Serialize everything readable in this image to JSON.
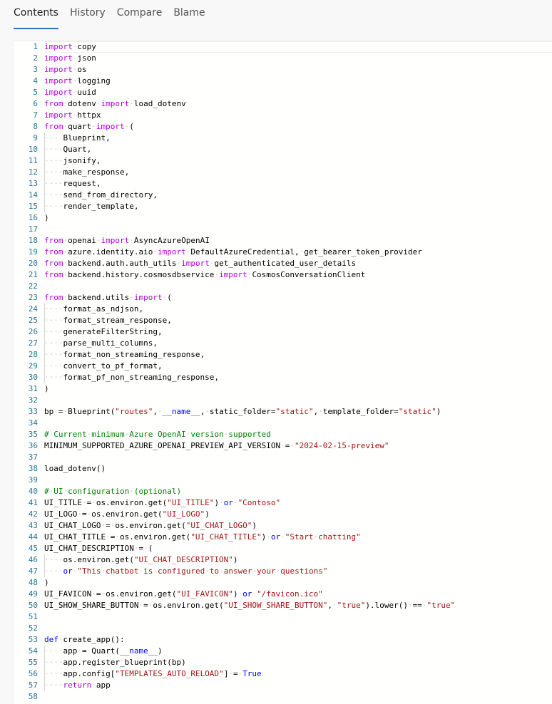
{
  "tabs": [
    {
      "label": "Contents",
      "active": true
    },
    {
      "label": "History",
      "active": false
    },
    {
      "label": "Compare",
      "active": false
    },
    {
      "label": "Blame",
      "active": false
    }
  ],
  "editor": {
    "current_line": 1,
    "lines": [
      "import copy",
      "import json",
      "import os",
      "import logging",
      "import uuid",
      "from dotenv import load_dotenv",
      "import httpx",
      "from quart import (",
      "    Blueprint,",
      "    Quart,",
      "    jsonify,",
      "    make_response,",
      "    request,",
      "    send_from_directory,",
      "    render_template,",
      ")",
      "",
      "from openai import AsyncAzureOpenAI",
      "from azure.identity.aio import DefaultAzureCredential, get_bearer_token_provider",
      "from backend.auth.auth_utils import get_authenticated_user_details",
      "from backend.history.cosmosdbservice import CosmosConversationClient",
      "",
      "from backend.utils import (",
      "    format_as_ndjson,",
      "    format_stream_response,",
      "    generateFilterString,",
      "    parse_multi_columns,",
      "    format_non_streaming_response,",
      "    convert_to_pf_format,",
      "    format_pf_non_streaming_response,",
      ")",
      "",
      "bp = Blueprint(\"routes\", __name__, static_folder=\"static\", template_folder=\"static\")",
      "",
      "# Current minimum Azure OpenAI version supported",
      "MINIMUM_SUPPORTED_AZURE_OPENAI_PREVIEW_API_VERSION = \"2024-02-15-preview\"",
      "",
      "load_dotenv()",
      "",
      "# UI configuration (optional)",
      "UI_TITLE = os.environ.get(\"UI_TITLE\") or \"Contoso\"",
      "UI_LOGO = os.environ.get(\"UI_LOGO\")",
      "UI_CHAT_LOGO = os.environ.get(\"UI_CHAT_LOGO\")",
      "UI_CHAT_TITLE = os.environ.get(\"UI_CHAT_TITLE\") or \"Start chatting\"",
      "UI_CHAT_DESCRIPTION = (",
      "    os.environ.get(\"UI_CHAT_DESCRIPTION\")",
      "    or \"This chatbot is configured to answer your questions\"",
      ")",
      "UI_FAVICON = os.environ.get(\"UI_FAVICON\") or \"/favicon.ico\"",
      "UI_SHOW_SHARE_BUTTON = os.environ.get(\"UI_SHOW_SHARE_BUTTON\", \"true\").lower() == \"true\"",
      "",
      "",
      "def create_app():",
      "    app = Quart(__name__)",
      "    app.register_blueprint(bp)",
      "    app.config[\"TEMPLATES_AUTO_RELOAD\"] = True",
      "    return app",
      ""
    ]
  }
}
